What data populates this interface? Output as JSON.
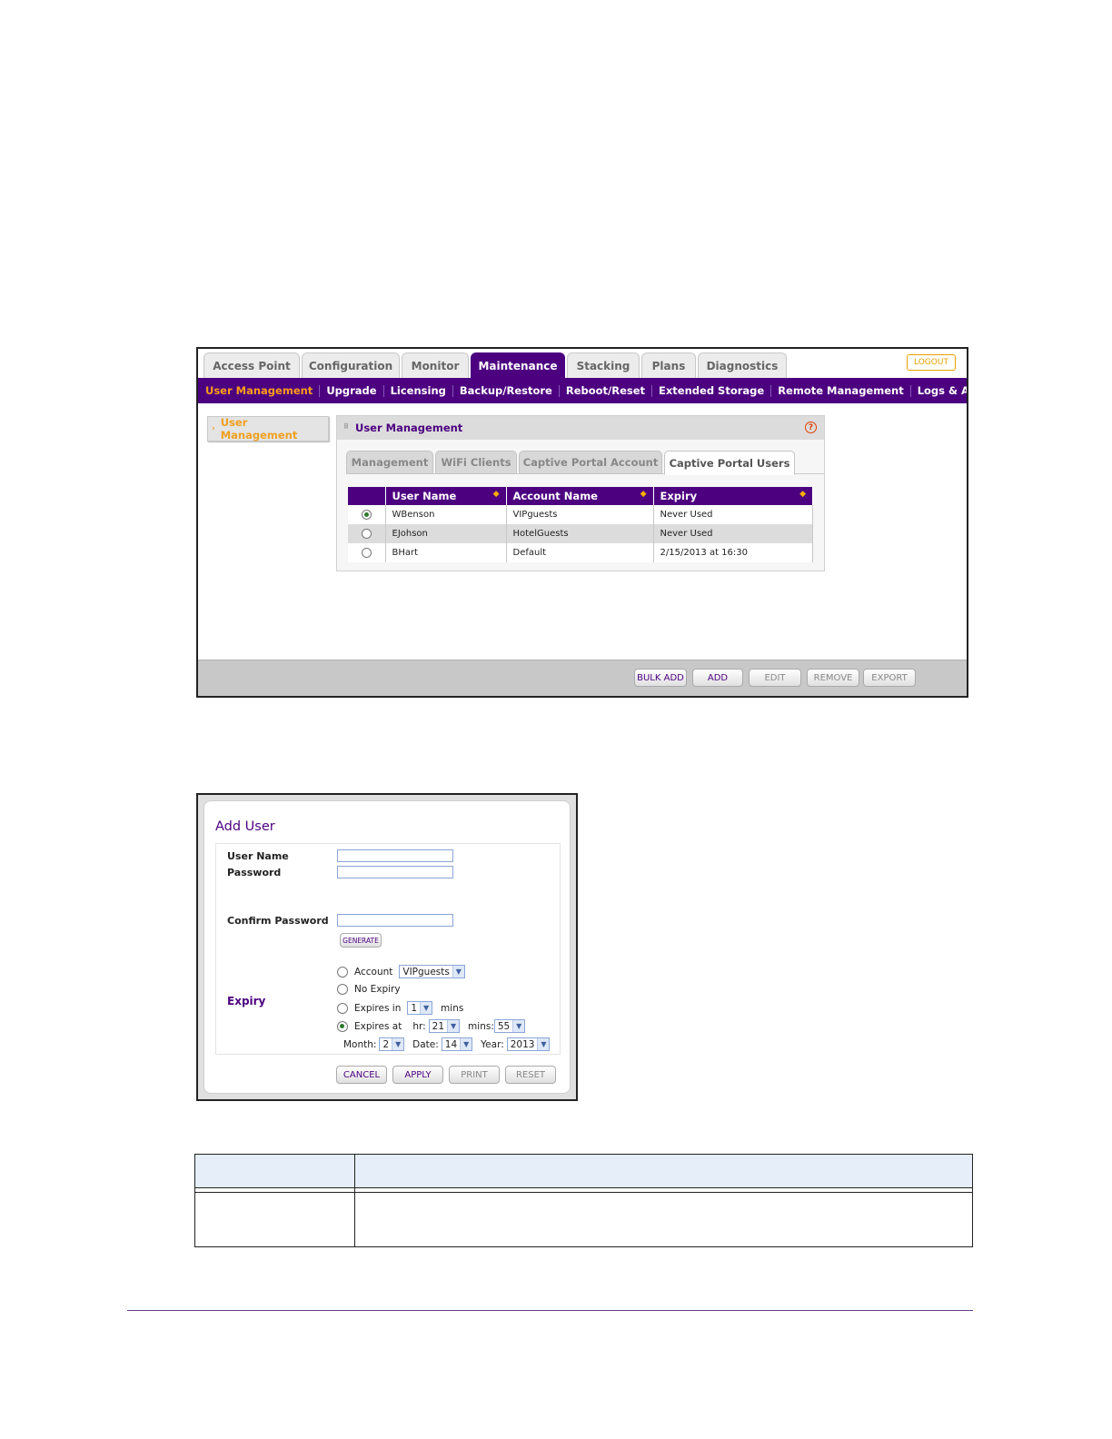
{
  "user_management": {
    "top_tabs": [
      {
        "label": "Access Point",
        "active": false
      },
      {
        "label": "Configuration",
        "active": false
      },
      {
        "label": "Monitor",
        "active": false
      },
      {
        "label": "Maintenance",
        "active": true
      },
      {
        "label": "Stacking",
        "active": false
      },
      {
        "label": "Plans",
        "active": false
      },
      {
        "label": "Diagnostics",
        "active": false
      }
    ],
    "logout_label": "LOGOUT",
    "sub_nav": [
      {
        "label": "User Management",
        "active": true
      },
      {
        "label": "Upgrade",
        "active": false
      },
      {
        "label": "Licensing",
        "active": false
      },
      {
        "label": "Backup/Restore",
        "active": false
      },
      {
        "label": "Reboot/Reset",
        "active": false
      },
      {
        "label": "Extended Storage",
        "active": false
      },
      {
        "label": "Remote Management",
        "active": false
      },
      {
        "label": "Logs & Alerts",
        "active": false
      }
    ],
    "left_nav_item": "User Management",
    "panel_title": "User Management",
    "help_icon": "?",
    "sub_tabs": [
      {
        "label": "Management",
        "active": false
      },
      {
        "label": "WiFi Clients",
        "active": false
      },
      {
        "label": "Captive Portal Account",
        "active": false
      },
      {
        "label": "Captive Portal Users",
        "active": true
      }
    ],
    "table": {
      "columns": [
        "",
        "User Name",
        "Account Name",
        "Expiry"
      ],
      "rows": [
        {
          "selected": true,
          "user_name": "WBenson",
          "account_name": "VIPguests",
          "expiry": "Never Used"
        },
        {
          "selected": false,
          "user_name": "EJohson",
          "account_name": "HotelGuests",
          "expiry": "Never Used"
        },
        {
          "selected": false,
          "user_name": "BHart",
          "account_name": "Default",
          "expiry": "2/15/2013 at 16:30"
        }
      ]
    },
    "actions": [
      {
        "label": "BULK ADD",
        "enabled": true
      },
      {
        "label": "ADD",
        "enabled": true
      },
      {
        "label": "EDIT",
        "enabled": false
      },
      {
        "label": "REMOVE",
        "enabled": false
      },
      {
        "label": "EXPORT",
        "enabled": false
      }
    ]
  },
  "add_user": {
    "title": "Add User",
    "user_name_label": "User Name",
    "password_label": "Password",
    "generate_label": "GENERATE",
    "confirm_password_label": "Confirm Password",
    "user_name_value": "",
    "password_value": "",
    "confirm_password_value": "",
    "expiry_heading": "Expiry",
    "options": {
      "account": {
        "label": "Account",
        "selected": false,
        "value": "VIPguests"
      },
      "no_expiry": {
        "label": "No Expiry",
        "selected": false
      },
      "expires_in": {
        "label": "Expires in",
        "selected": false,
        "value": "1",
        "unit": "mins"
      },
      "expires_at": {
        "label": "Expires at",
        "selected": true,
        "hr_label": "hr:",
        "hr": "21",
        "mins_label": "mins:",
        "mins": "55"
      }
    },
    "date": {
      "month_label": "Month:",
      "month": "2",
      "date_label": "Date:",
      "date": "14",
      "year_label": "Year:",
      "year": "2013"
    },
    "buttons": [
      {
        "label": "CANCEL",
        "enabled": true
      },
      {
        "label": "APPLY",
        "enabled": true
      },
      {
        "label": "PRINT",
        "enabled": false
      },
      {
        "label": "RESET",
        "enabled": false
      }
    ]
  },
  "colors": {
    "brand_purple": "#4c0080",
    "accent_orange": "#ff9d1a"
  }
}
